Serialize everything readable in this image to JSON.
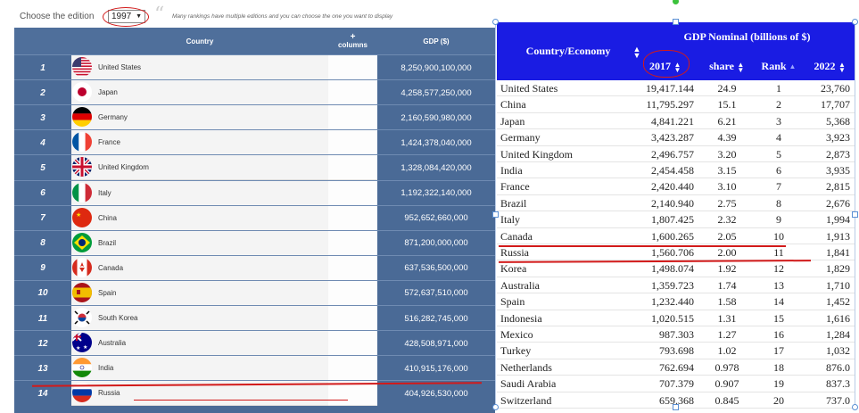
{
  "edition": {
    "label": "Choose the edition",
    "selected": "1997",
    "quote": "“",
    "note": "Many rankings have multiple editions and you can choose the one you want to display"
  },
  "rank_table": {
    "headers": {
      "country": "Country",
      "columns_plus": "+",
      "columns": "columns",
      "gdp": "GDP ($)"
    },
    "rows": [
      {
        "rank": "1",
        "country": "United States",
        "gdp": "8,250,900,100,000",
        "flag": "us-flag-icon"
      },
      {
        "rank": "2",
        "country": "Japan",
        "gdp": "4,258,577,250,000",
        "flag": "jp-flag-icon"
      },
      {
        "rank": "3",
        "country": "Germany",
        "gdp": "2,160,590,980,000",
        "flag": "de-flag-icon"
      },
      {
        "rank": "4",
        "country": "France",
        "gdp": "1,424,378,040,000",
        "flag": "fr-flag-icon"
      },
      {
        "rank": "5",
        "country": "United Kingdom",
        "gdp": "1,328,084,420,000",
        "flag": "uk-flag-icon"
      },
      {
        "rank": "6",
        "country": "Italy",
        "gdp": "1,192,322,140,000",
        "flag": "it-flag-icon"
      },
      {
        "rank": "7",
        "country": "China",
        "gdp": "952,652,660,000",
        "flag": "cn-flag-icon"
      },
      {
        "rank": "8",
        "country": "Brazil",
        "gdp": "871,200,000,000",
        "flag": "br-flag-icon"
      },
      {
        "rank": "9",
        "country": "Canada",
        "gdp": "637,536,500,000",
        "flag": "ca-flag-icon"
      },
      {
        "rank": "10",
        "country": "Spain",
        "gdp": "572,637,510,000",
        "flag": "es-flag-icon"
      },
      {
        "rank": "11",
        "country": "South Korea",
        "gdp": "516,282,745,000",
        "flag": "kr-flag-icon"
      },
      {
        "rank": "12",
        "country": "Australia",
        "gdp": "428,508,971,000",
        "flag": "au-flag-icon"
      },
      {
        "rank": "13",
        "country": "India",
        "gdp": "410,915,176,000",
        "flag": "in-flag-icon"
      },
      {
        "rank": "14",
        "country": "Russia",
        "gdp": "404,926,530,000",
        "flag": "ru-flag-icon"
      }
    ]
  },
  "gdp_table": {
    "headers": {
      "country": "Country/Economy",
      "group": "GDP Nominal (billions of $)",
      "y2017": "2017",
      "share": "share",
      "rank": "Rank",
      "y2022": "2022",
      "sort_both": "▲▼",
      "sort_up": "▲"
    },
    "rows": [
      {
        "country": "United States",
        "v2017": "19,417.144",
        "share": "24.9",
        "rank": "1",
        "v2022": "23,760"
      },
      {
        "country": "China",
        "v2017": "11,795.297",
        "share": "15.1",
        "rank": "2",
        "v2022": "17,707"
      },
      {
        "country": "Japan",
        "v2017": "4,841.221",
        "share": "6.21",
        "rank": "3",
        "v2022": "5,368"
      },
      {
        "country": "Germany",
        "v2017": "3,423.287",
        "share": "4.39",
        "rank": "4",
        "v2022": "3,923"
      },
      {
        "country": "United Kingdom",
        "v2017": "2,496.757",
        "share": "3.20",
        "rank": "5",
        "v2022": "2,873"
      },
      {
        "country": "India",
        "v2017": "2,454.458",
        "share": "3.15",
        "rank": "6",
        "v2022": "3,935"
      },
      {
        "country": "France",
        "v2017": "2,420.440",
        "share": "3.10",
        "rank": "7",
        "v2022": "2,815"
      },
      {
        "country": "Brazil",
        "v2017": "2,140.940",
        "share": "2.75",
        "rank": "8",
        "v2022": "2,676"
      },
      {
        "country": "Italy",
        "v2017": "1,807.425",
        "share": "2.32",
        "rank": "9",
        "v2022": "1,994"
      },
      {
        "country": "Canada",
        "v2017": "1,600.265",
        "share": "2.05",
        "rank": "10",
        "v2022": "1,913"
      },
      {
        "country": "Russia",
        "v2017": "1,560.706",
        "share": "2.00",
        "rank": "11",
        "v2022": "1,841"
      },
      {
        "country": "Korea",
        "v2017": "1,498.074",
        "share": "1.92",
        "rank": "12",
        "v2022": "1,829"
      },
      {
        "country": "Australia",
        "v2017": "1,359.723",
        "share": "1.74",
        "rank": "13",
        "v2022": "1,710"
      },
      {
        "country": "Spain",
        "v2017": "1,232.440",
        "share": "1.58",
        "rank": "14",
        "v2022": "1,452"
      },
      {
        "country": "Indonesia",
        "v2017": "1,020.515",
        "share": "1.31",
        "rank": "15",
        "v2022": "1,616"
      },
      {
        "country": "Mexico",
        "v2017": "987.303",
        "share": "1.27",
        "rank": "16",
        "v2022": "1,284"
      },
      {
        "country": "Turkey",
        "v2017": "793.698",
        "share": "1.02",
        "rank": "17",
        "v2022": "1,032"
      },
      {
        "country": "Netherlands",
        "v2017": "762.694",
        "share": "0.978",
        "rank": "18",
        "v2022": "876.0"
      },
      {
        "country": "Saudi Arabia",
        "v2017": "707.379",
        "share": "0.907",
        "rank": "19",
        "v2022": "837.3"
      },
      {
        "country": "Switzerland",
        "v2017": "659.368",
        "share": "0.845",
        "rank": "20",
        "v2022": "737.0"
      }
    ]
  },
  "colors": {
    "left_header": "#4f6f9b",
    "right_header": "#1a1ce3",
    "annotation": "#d21a1a"
  }
}
